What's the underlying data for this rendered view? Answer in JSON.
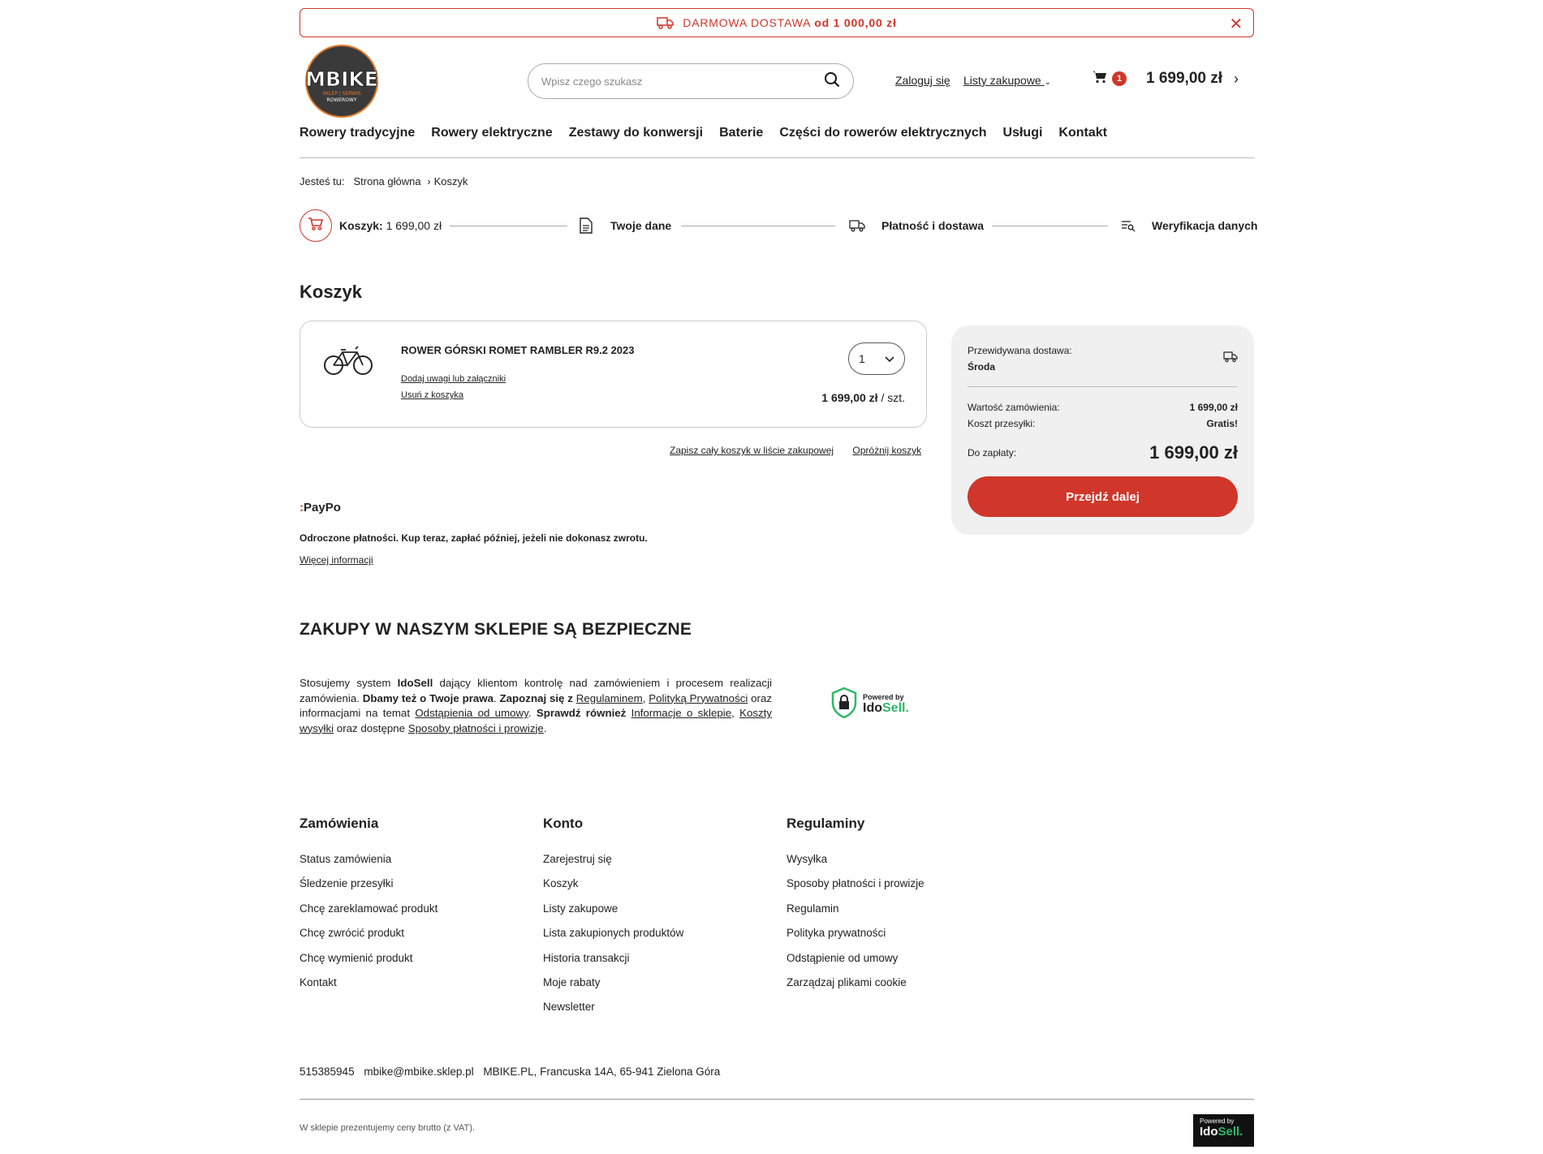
{
  "banner": {
    "text": "DARMOWA DOSTAWA",
    "bold": "od 1 000,00 zł"
  },
  "logo": {
    "name": "MBIKE",
    "tagline_1": "SKLEP | SERWIS",
    "tagline_2": "ROWEROWY"
  },
  "search": {
    "placeholder": "Wpisz czego szukasz"
  },
  "header": {
    "login": "Zaloguj się",
    "shopping_lists": "Listy zakupowe",
    "cart_count": "1",
    "cart_total": "1 699,00 zł"
  },
  "nav": [
    "Rowery tradycyjne",
    "Rowery elektryczne",
    "Zestawy do konwersji",
    "Baterie",
    "Części do rowerów elektrycznych",
    "Usługi",
    "Kontakt"
  ],
  "breadcrumb": {
    "label": "Jesteś tu:",
    "home": "Strona główna",
    "current": "Koszyk"
  },
  "steps": {
    "cart_label": "Koszyk:",
    "cart_value": "1 699,00 zł",
    "data": "Twoje dane",
    "payment": "Płatność i dostawa",
    "verify": "Weryfikacja danych"
  },
  "page_title": "Koszyk",
  "item": {
    "name": "ROWER GÓRSKI ROMET RAMBLER R9.2 2023",
    "add_notes": "Dodaj uwagi lub załączniki",
    "remove": "Usuń z koszyka",
    "qty": "1",
    "price": "1 699,00 zł",
    "per_unit": "/ szt."
  },
  "cart_actions": {
    "save_list": "Zapisz cały koszyk w liście zakupowej",
    "empty": "Opróżnij koszyk"
  },
  "summary": {
    "delivery_label": "Przewidywana dostawa:",
    "delivery_day": "Środa",
    "order_value_label": "Wartość zamówienia:",
    "order_value": "1 699,00 zł",
    "shipping_label": "Koszt przesyłki:",
    "shipping_value": "Gratis!",
    "to_pay_label": "Do zapłaty:",
    "to_pay": "1 699,00 zł",
    "next_button": "Przejdź dalej"
  },
  "paypo": {
    "logo": "PayPo",
    "text": "Odroczone płatności. Kup teraz, zapłać później, jeżeli nie dokonasz zwrotu.",
    "more": "Więcej informacji"
  },
  "secure": {
    "title": "ZAKUPY W NASZYM SKLEPIE SĄ BEZPIECZNE",
    "t1": "Stosujemy system ",
    "t1b": "IdoSell",
    "t2": " dający klientom kontrolę nad zamówieniem i procesem realizacji zamówienia. ",
    "t2b": "Dbamy też o Twoje prawa",
    "t3": ". ",
    "t3b": "Zapoznaj się z",
    "l1": "Regulaminem",
    "t4": ", ",
    "l2": "Polityką Prywatności",
    "t5": " oraz informacjami na temat ",
    "l3": "Odstąpienia od umowy",
    "t6": ". ",
    "t6b": "Sprawdź również",
    "l4": "Informacje o sklepie",
    "t7": ", ",
    "l5": "Koszty wysyłki",
    "t8": " oraz dostępne ",
    "l6": "Sposoby płatności i prowizje",
    "t9": ".",
    "badge_small": "Powered by",
    "badge_ido": "Ido",
    "badge_sell": "Sell."
  },
  "footer": {
    "orders": {
      "title": "Zamówienia",
      "items": [
        "Status zamówienia",
        "Śledzenie przesyłki",
        "Chcę zareklamować produkt",
        "Chcę zwrócić produkt",
        "Chcę wymienić produkt",
        "Kontakt"
      ]
    },
    "account": {
      "title": "Konto",
      "items": [
        "Zarejestruj się",
        "Koszyk",
        "Listy zakupowe",
        "Lista zakupionych produktów",
        "Historia transakcji",
        "Moje rabaty",
        "Newsletter"
      ]
    },
    "rules": {
      "title": "Regulaminy",
      "items": [
        "Wysyłka",
        "Sposoby płatności i prowizje",
        "Regulamin",
        "Polityka prywatności",
        "Odstąpienie od umowy",
        "Zarządzaj plikami cookie"
      ]
    },
    "phone": "515385945",
    "email": "mbike@mbike.sklep.pl",
    "address": "MBIKE.PL, Francuska 14A, 65-941 Zielona Góra",
    "vat_note": "W sklepie prezentujemy ceny brutto (z VAT).",
    "powered_small": "Powered by",
    "powered_ido": "Ido",
    "powered_sell": "Sell."
  },
  "colors": {
    "accent": "#d0362a",
    "summary_bg": "#f0f0f0",
    "idosell_green": "#2fb96a"
  }
}
